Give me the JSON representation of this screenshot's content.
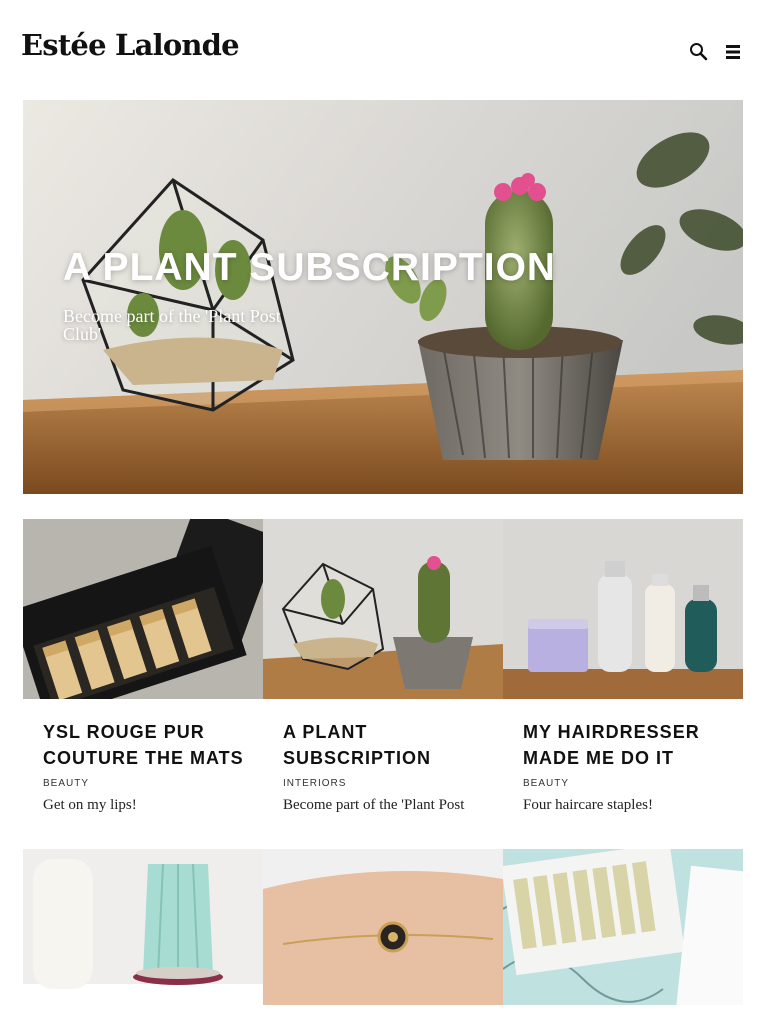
{
  "site": {
    "logo": "Estée Lalonde"
  },
  "header": {
    "search_icon": "search-icon",
    "menu_icon": "hamburger-menu-icon"
  },
  "hero": {
    "title": "A PLANT SUBSCRIPTION",
    "subtitle": "Become part of the 'Plant Post Club'"
  },
  "cards": [
    {
      "title": "YSL ROUGE PUR COUTURE THE MATS",
      "category": "BEAUTY",
      "description": "Get on my lips!"
    },
    {
      "title": "A PLANT SUBSCRIPTION",
      "category": "INTERIORS",
      "description": "Become part of the 'Plant Post"
    },
    {
      "title": "MY HAIRDRESSER MADE ME DO IT",
      "category": "BEAUTY",
      "description": "Four haircare staples!"
    }
  ],
  "colors": {
    "text": "#111111",
    "background": "#ffffff",
    "overlay_text": "#ffffff"
  }
}
